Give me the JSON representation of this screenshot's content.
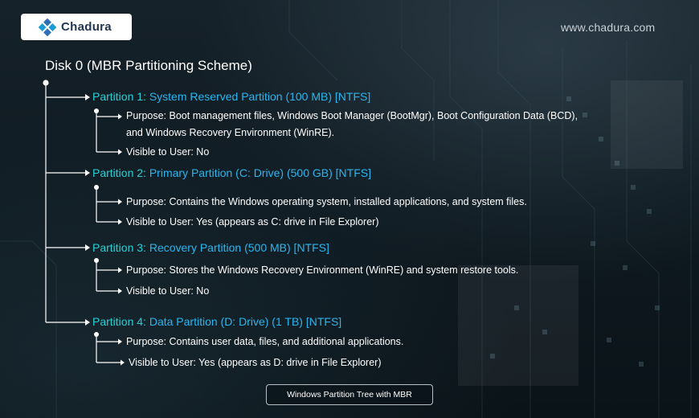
{
  "brand": {
    "name": "Chadura",
    "website": "www.chadura.com"
  },
  "tree": {
    "disk_title": "Disk 0 (MBR Partitioning Scheme)",
    "partitions": [
      {
        "label": "Partition 1:",
        "name": "System Reserved Partition (100 MB) [NTFS]",
        "purpose": "Purpose: Boot management files, Windows Boot Manager (BootMgr), Boot Configuration Data (BCD), and Windows Recovery Environment (WinRE).",
        "visible": "Visible to User: No"
      },
      {
        "label": "Partition 2:",
        "name": "Primary Partition (C: Drive) (500 GB) [NTFS]",
        "purpose": "Purpose: Contains the Windows operating system, installed applications, and system files.",
        "visible": "Visible to User: Yes (appears as C: drive in File Explorer)"
      },
      {
        "label": "Partition 3:",
        "name": "Recovery Partition (500 MB) [NTFS]",
        "purpose": "Purpose: Stores the Windows Recovery Environment (WinRE) and system restore tools.",
        "visible": "Visible to User: No"
      },
      {
        "label": "Partition 4:",
        "name": "Data Partition (D: Drive) (1 TB) [NTFS]",
        "purpose": "Purpose: Contains user data, files, and additional applications.",
        "visible": "Visible to User: Yes (appears as D: drive in File Explorer)"
      }
    ]
  },
  "caption": "Windows Partition Tree with MBR",
  "colors": {
    "partition_label": "#27d1d6",
    "partition_name": "#29b6f0",
    "text": "#ffffff",
    "background": "#0f1a21"
  }
}
